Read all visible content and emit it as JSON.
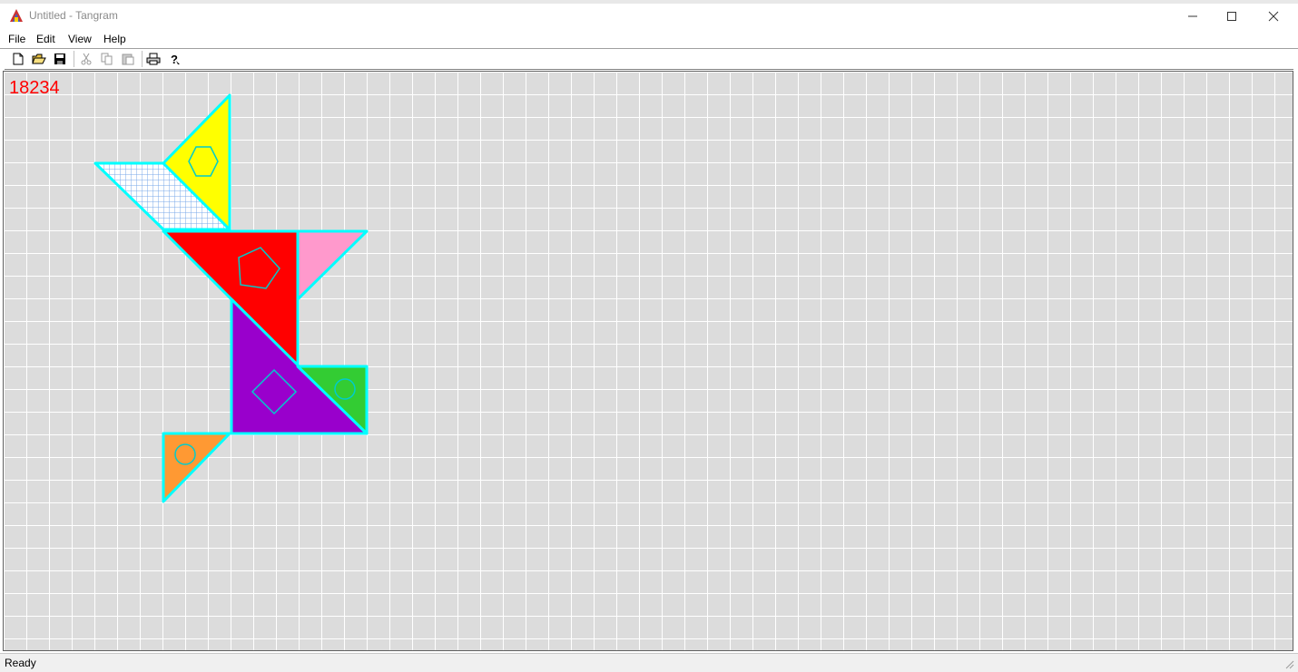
{
  "window": {
    "title": "Untitled - Tangram"
  },
  "menu": {
    "file": "File",
    "edit": "Edit",
    "view": "View",
    "help": "Help"
  },
  "toolbar": {
    "buttons": [
      "new-icon",
      "open-icon",
      "save-icon",
      "cut-icon",
      "copy-icon",
      "paste-icon",
      "print-icon",
      "help-icon"
    ]
  },
  "canvas": {
    "counter": "18234"
  },
  "status": {
    "text": "Ready"
  },
  "colors": {
    "grid_bg": "#dcdcdc",
    "grid_line": "#ffffff",
    "outline": "#00ffff",
    "yellow": "#ffff00",
    "red": "#ff0000",
    "pink": "#ff99cc",
    "purple": "#9900cc",
    "green": "#33cc33",
    "orange": "#ff9933",
    "counter": "#ff0000"
  }
}
